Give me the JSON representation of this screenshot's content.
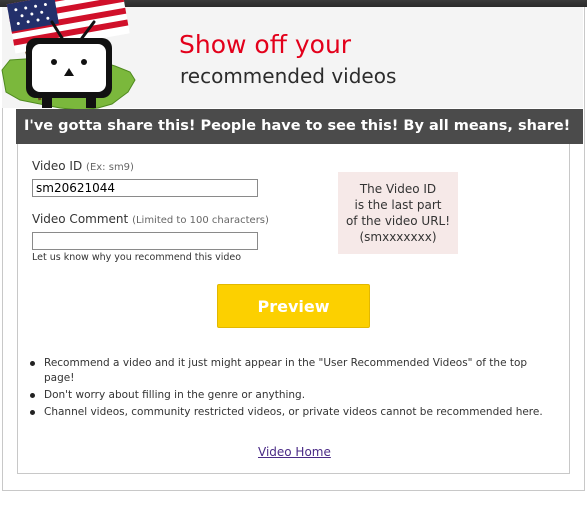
{
  "header": {
    "title_line1": "Show off your",
    "title_line2": "recommended videos"
  },
  "banner": {
    "text": "I've gotta share this! People have to see this! By all means, share!"
  },
  "form": {
    "video_id_label": "Video ID",
    "video_id_hint": "(Ex: sm9)",
    "video_id_value": "sm20621044",
    "comment_label": "Video Comment",
    "comment_hint": "(Limited to 100 characters)",
    "comment_value": "",
    "comment_help": "Let us know why you recommend this video",
    "preview_button": "Preview"
  },
  "hint_box": {
    "lines": [
      "The Video ID",
      "is the last part",
      "of the video URL!",
      "(smxxxxxxx)"
    ]
  },
  "notes": [
    "Recommend a video and it just might appear in the \"User Recommended Videos\" of the top page!",
    "Don't worry about filling in the genre or anything.",
    "Channel videos, community restricted videos, or private videos cannot be recommended here."
  ],
  "footer": {
    "video_home_link": "Video Home"
  },
  "colors": {
    "title_red": "#e3001b",
    "banner_bg": "#4b4b4b",
    "button_yellow": "#fcd000",
    "hint_box_bg": "#f6e9e8"
  },
  "icons": {
    "mascot": "niconico-tv-mascot-with-us-flag-icon"
  }
}
